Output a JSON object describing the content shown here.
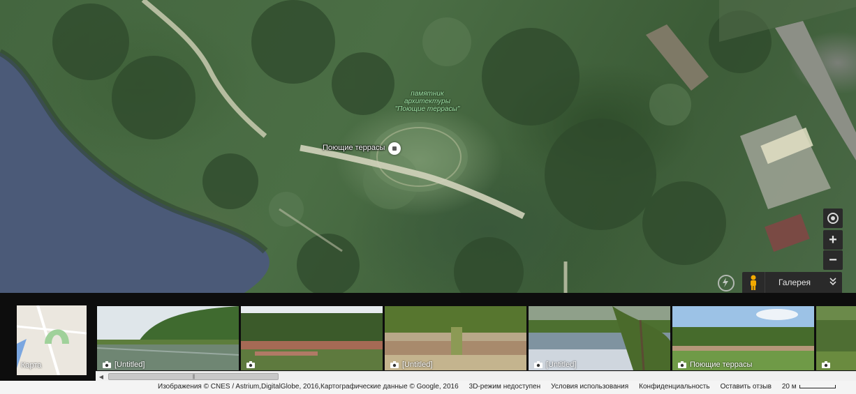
{
  "map": {
    "place_label": "Поющие террасы",
    "landmark_label": "памятник архитектуры \"Поющие террасы\"",
    "controls": {
      "locate_icon": "locate-icon",
      "zoom_in_label": "+",
      "zoom_out_label": "−"
    },
    "gallery": {
      "label": "Галерея",
      "chevron": "⌄⌄"
    }
  },
  "strip": {
    "map_thumb_label": "Карта",
    "photos": [
      {
        "caption": "[Untitled]",
        "scene": "river"
      },
      {
        "caption": "",
        "scene": "terraces"
      },
      {
        "caption": "[Untitled]",
        "scene": "stairs"
      },
      {
        "caption": "[Untitled]",
        "scene": "lake"
      },
      {
        "caption": "Поющие террасы",
        "scene": "field"
      },
      {
        "caption": "",
        "scene": "trees"
      }
    ]
  },
  "footer": {
    "imagery": "Изображения © CNES / Astrium,DigitalGlobe, 2016,Картографические данные © Google, 2016",
    "mode_3d": "3D-режим недоступен",
    "terms": "Условия использования",
    "privacy": "Конфиденциальность",
    "feedback": "Оставить отзыв",
    "scale": "20 м"
  },
  "colors": {
    "water": "#4b5a78",
    "forest": "#3f6139",
    "path": "#c9cbb0",
    "control_bg": "#2a2a2a",
    "landmark_text": "#9fe3a6"
  }
}
